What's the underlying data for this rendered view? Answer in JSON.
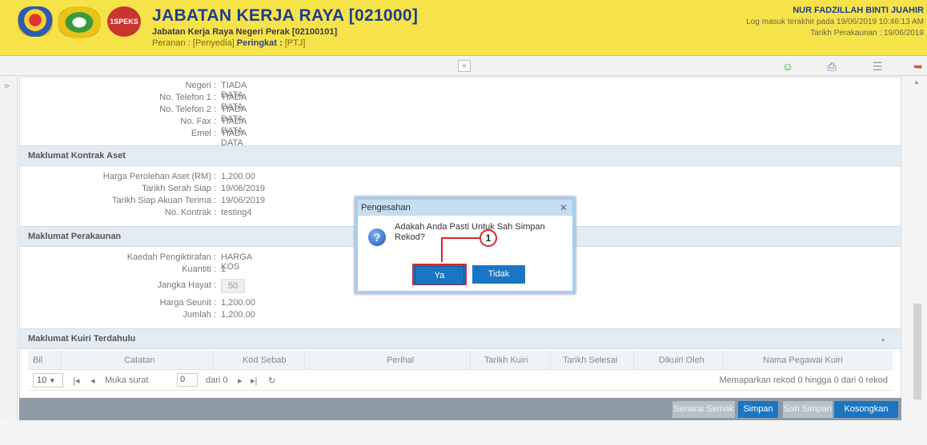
{
  "header": {
    "logo_badge": "1SPEKS",
    "title": "JABATAN KERJA RAYA [021000]",
    "subtitle": "Jabatan Kerja Raya Negeri Perak [02100101]",
    "role_label": "Peranan : ",
    "role_value": "[Penyedia]",
    "level_label": " Peringkat : ",
    "level_value": "[PTJ]",
    "user": "NUR FADZILLAH BINTI JUAHIR",
    "last_login": "Log masuk terakhir pada 19/06/2019 10:46:13 AM",
    "account_date": "Tarikh Perakaunan : 19/06/2019"
  },
  "contact": [
    {
      "label": "Negeri :",
      "value": "TIADA DATA"
    },
    {
      "label": "No. Telefon 1 :",
      "value": "TIADA DATA"
    },
    {
      "label": "No. Telefon 2 :",
      "value": "TIADA DATA"
    },
    {
      "label": "No. Fax :",
      "value": "TIADA DATA"
    },
    {
      "label": "Emel :",
      "value": "TIADA DATA"
    }
  ],
  "section_contract": {
    "title": "Maklumat Kontrak Aset",
    "fields": [
      {
        "label": "Harga Perolehan Aset (RM) :",
        "value": "1,200.00"
      },
      {
        "label": "Tarikh Serah Siap :",
        "value": "19/06/2019"
      },
      {
        "label": "Tarikh Siap Akuan Terima :",
        "value": "19/06/2019"
      },
      {
        "label": "No. Kontrak :",
        "value": "testing4"
      }
    ]
  },
  "section_accounting": {
    "title": "Maklumat Perakaunan",
    "fields": [
      {
        "label": "Kaedah Pengiktirafan :",
        "value": "HARGA KOS"
      },
      {
        "label": "Kuantiti :",
        "value": "1"
      },
      {
        "label": "Jangka Hayat :",
        "value": "50"
      },
      {
        "label": "Harga Seunit :",
        "value": "1,200.00"
      },
      {
        "label": "Jumlah :",
        "value": "1,200.00"
      }
    ]
  },
  "section_query": {
    "title": "Maklumat Kuiri Terdahulu",
    "columns": [
      "Bil",
      "Catatan",
      "Kod Sebab",
      "Perihal",
      "Tarikh Kuiri",
      "Tarikh Selesai",
      "Dikuiri Oleh",
      "Nama Pegawai Kuiri"
    ],
    "pager": {
      "page_size": "10",
      "page_label": "Muka surat",
      "page_value": "0",
      "of_label": "dari 0",
      "summary": "Memaparkan rekod 0 hingga 0 dari 0 rekod"
    }
  },
  "footer_buttons": {
    "checklist": "Senarai Semak",
    "save": "Simpan",
    "confirm_save": "Sah Simpan",
    "clear": "Kosongkan"
  },
  "dialog": {
    "title": "Pengesahan",
    "message": "Adakah Anda Pasti Untuk Sah Simpan Rekod?",
    "yes": "Ya",
    "no": "Tidak",
    "callout": "1"
  },
  "colors": {
    "header_bg": "#f6e34a",
    "title": "#1f3d8a",
    "section_bg": "#e4ecf3",
    "primary_button": "#1a76c2",
    "highlight": "#d9262d"
  }
}
